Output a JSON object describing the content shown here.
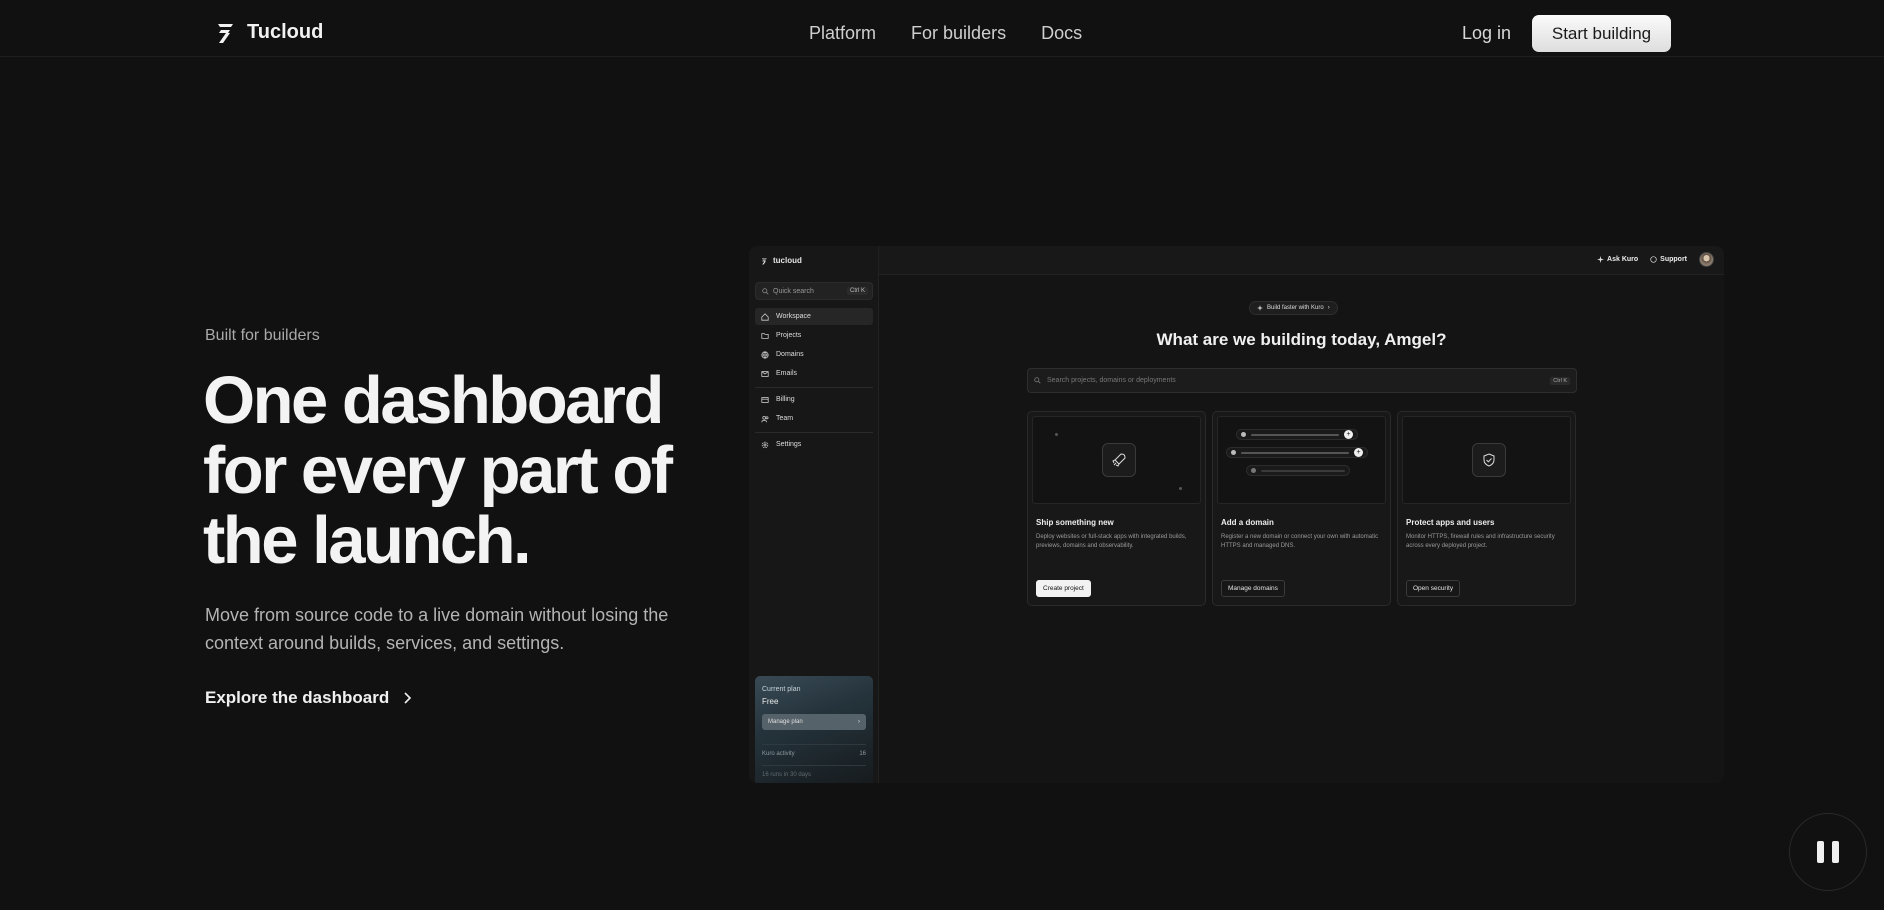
{
  "nav": {
    "brand": "Tucloud",
    "links": [
      "Platform",
      "For builders",
      "Docs"
    ],
    "login": "Log in",
    "cta": "Start building"
  },
  "hero": {
    "eyebrow": "Built for builders",
    "headline": "One dashboard for every part of the launch.",
    "sub": "Move from source code to a live domain without losing the context around builds, services, and settings.",
    "link": "Explore the dashboard"
  },
  "app": {
    "brand": "tucloud",
    "quick_search": "Quick search",
    "quick_search_kbd": "Ctrl K",
    "sidebar": [
      "Workspace",
      "Projects",
      "Domains",
      "Emails",
      "Billing",
      "Team",
      "Settings"
    ],
    "topbar": {
      "ask": "Ask Kuro",
      "support": "Support"
    },
    "pill": "Build faster with Kuro",
    "greeting": "What are we building today, Amgel?",
    "search_placeholder": "Search projects, domains or deployments",
    "search_kbd": "Ctrl K",
    "cards": [
      {
        "title": "Ship something new",
        "desc": "Deploy websites or full-stack apps with integrated builds, previews, domains and observability.",
        "button": "Create project"
      },
      {
        "title": "Add a domain",
        "desc": "Register a new domain or connect your own with automatic HTTPS and managed DNS.",
        "button": "Manage domains"
      },
      {
        "title": "Protect apps and users",
        "desc": "Monitor HTTPS, firewall rules and infrastructure security across every deployed project.",
        "button": "Open security"
      }
    ],
    "plan": {
      "label": "Current plan",
      "value": "Free",
      "button": "Manage plan",
      "activity_label": "Kuro activity",
      "activity_value": "16",
      "activity_sub": "16 runs in 30 days"
    }
  }
}
